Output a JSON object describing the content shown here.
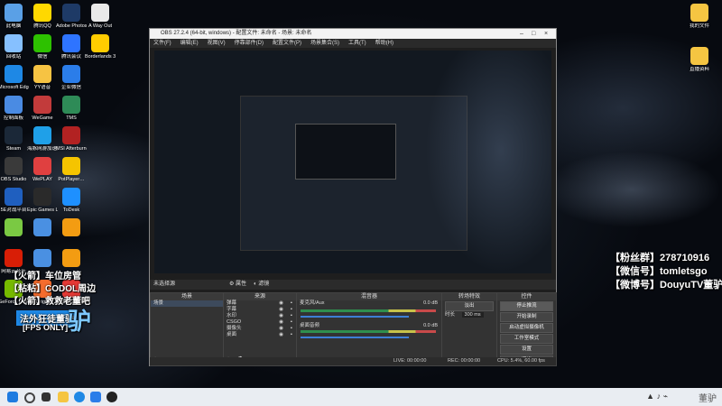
{
  "desktop_left": [
    {
      "label": "此电脑",
      "color": "#5aa0e6"
    },
    {
      "label": "腾讯QQ",
      "color": "#ffd800"
    },
    {
      "label": "Adobe Photosh…",
      "color": "#1e3a66"
    },
    {
      "label": "A Way Out",
      "color": "#e9e9e9"
    },
    {
      "label": "回收站",
      "color": "#86c0ff"
    },
    {
      "label": "微信",
      "color": "#2dc100"
    },
    {
      "label": "腾讯会议",
      "color": "#2e74ff"
    },
    {
      "label": "Borderlands 3",
      "color": "#ffcc00"
    },
    {
      "label": "Microsoft Edge",
      "color": "#1e88e5"
    },
    {
      "label": "YY语音",
      "color": "#f6c343"
    },
    {
      "label": "企业微信",
      "color": "#2b7de9"
    },
    {
      "label": "控制面板",
      "color": "#4a8be3"
    },
    {
      "label": "WeGame",
      "color": "#c23b3b"
    },
    {
      "label": "TMS",
      "color": "#2e8b57"
    },
    {
      "label": "Steam",
      "color": "#1b2838"
    },
    {
      "label": "海豚网游加速器5.0",
      "color": "#1fa0e8"
    },
    {
      "label": "MSI Afterburner",
      "color": "#b22222"
    },
    {
      "label": "OBS Studio",
      "color": "#3a3a3a"
    },
    {
      "label": "WePLAY",
      "color": "#e04040"
    },
    {
      "label": "PotPlayer…",
      "color": "#f5c400"
    },
    {
      "label": "5E对战平台",
      "color": "#1f5fbf"
    },
    {
      "label": "Epic Games Launcher",
      "color": "#2a2a2a"
    },
    {
      "label": "ToDesk",
      "color": "#1e90ff"
    },
    {
      "label": "",
      "color": "#7ac943"
    },
    {
      "label": "",
      "color": "#4a90e2"
    },
    {
      "label": "",
      "color": "#f39c12"
    },
    {
      "label": "网易云音乐",
      "color": "#d81e06"
    },
    {
      "label": "",
      "color": "#4a90e2"
    },
    {
      "label": "",
      "color": "#f39c12"
    },
    {
      "label": "GeForce Experience",
      "color": "#76b900"
    },
    {
      "label": "Origin",
      "color": "#f56c2d"
    },
    {
      "label": "腾讯手游助手",
      "color": "#e53935"
    }
  ],
  "desktop_right": [
    {
      "label": "我的文件",
      "color": "#f5c542"
    },
    {
      "label": "直播资料",
      "color": "#f5c542"
    }
  ],
  "overlay_right": [
    "【粉丝群】278710916",
    "【微信号】tomletsgo",
    "【微博号】DouyuTV董驴"
  ],
  "overlay_left": [
    "【火箭】车位房管",
    "【粘粘】CODOL周边",
    "【火箭】救救老董吧"
  ],
  "overlay_banner": "法外狂徒董驴",
  "overlay_fps": "[FPS ONLY]",
  "obs": {
    "title": "OBS 27.2.4 (64-bit, windows) - 配置文件: 未命名 - 场景: 未命名",
    "menu": [
      "文件(F)",
      "编辑(E)",
      "视图(V)",
      "停靠部件(D)",
      "配置文件(P)",
      "场景集合(S)",
      "工具(T)",
      "帮助(H)"
    ],
    "scene_strip": "未选择源",
    "properties_btn": "属性",
    "filters_btn": "滤镜",
    "docks": {
      "scenes": {
        "header": "场景",
        "items": [
          "场景"
        ]
      },
      "sources": {
        "header": "来源",
        "items": [
          "弹幕",
          "字幕",
          "水印",
          "CSGO",
          "摄像头",
          "桌面"
        ]
      },
      "mixer": {
        "header": "混音器",
        "channels": [
          {
            "name": "麦克风/Aux",
            "db": "0.0 dB"
          },
          {
            "name": "桌面音频",
            "db": "0.0 dB"
          }
        ]
      },
      "transitions": {
        "header": "转场特效",
        "type": "淡出",
        "duration_label": "时长",
        "duration": "300 ms"
      },
      "controls": {
        "header": "控件",
        "buttons": [
          "停止推流",
          "开始录制",
          "启动虚拟摄像机",
          "工作室模式",
          "设置",
          "退出"
        ]
      }
    },
    "status": [
      "LIVE: 00:00:00",
      "REC: 00:00:00",
      "CPU: 5.4%, 60.00 fps"
    ]
  },
  "clock": "董驴"
}
